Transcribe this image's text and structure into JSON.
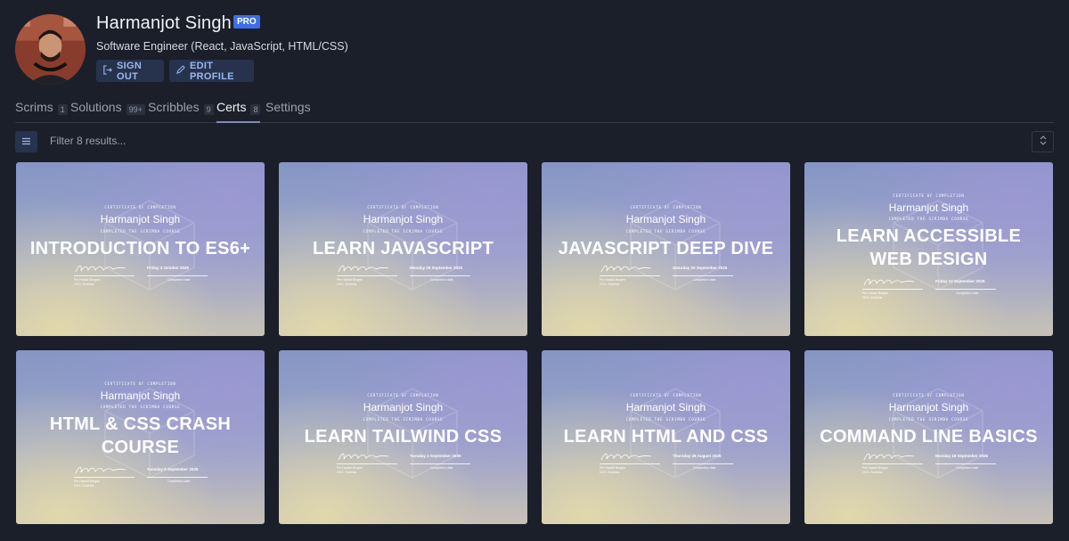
{
  "profile": {
    "name": "Harmanjot Singh",
    "badge": "PRO",
    "subtitle": "Software Engineer (React, JavaScript, HTML/CSS)",
    "sign_out_label": "SIGN OUT",
    "edit_profile_label": "EDIT PROFILE"
  },
  "tabs": [
    {
      "label": "Scrims",
      "count": "1"
    },
    {
      "label": "Solutions",
      "count": "99+"
    },
    {
      "label": "Scribbles",
      "count": "9"
    },
    {
      "label": "Certs",
      "count": "8",
      "active": true
    },
    {
      "label": "Settings"
    }
  ],
  "filter": {
    "placeholder": "Filter 8 results..."
  },
  "cert_common": {
    "heading": "CERTIFICATE OF COMPLETION",
    "recipient": "Harmanjot Singh",
    "subheading": "COMPLETED THE SCRIMBA COURSE",
    "signer": "Per Harald Borgen",
    "signer_role": "CEO, Scrimba",
    "date_label": "Completion date"
  },
  "certs": [
    {
      "title": "INTRODUCTION TO ES6+",
      "date": "Friday 3 October 2025"
    },
    {
      "title": "LEARN JAVASCRIPT",
      "date": "Monday 29 September 2025"
    },
    {
      "title": "JAVASCRIPT DEEP DIVE",
      "date": "Saturday 20 September 2025"
    },
    {
      "title": "LEARN ACCESSIBLE WEB DESIGN",
      "date": "Friday 12 September 2025"
    },
    {
      "title": "HTML & CSS CRASH COURSE",
      "date": "Tuesday 9 September 2025"
    },
    {
      "title": "LEARN TAILWIND CSS",
      "date": "Tuesday 2 September 2025"
    },
    {
      "title": "LEARN HTML AND CSS",
      "date": "Thursday 28 August 2025"
    },
    {
      "title": "COMMAND LINE BASICS",
      "date": "Monday 18 September 2025"
    }
  ],
  "colors": {
    "background": "#1b1f2a",
    "accent": "#3d6ee8",
    "button_bg": "#27334c",
    "button_text": "#9ab7f2"
  }
}
